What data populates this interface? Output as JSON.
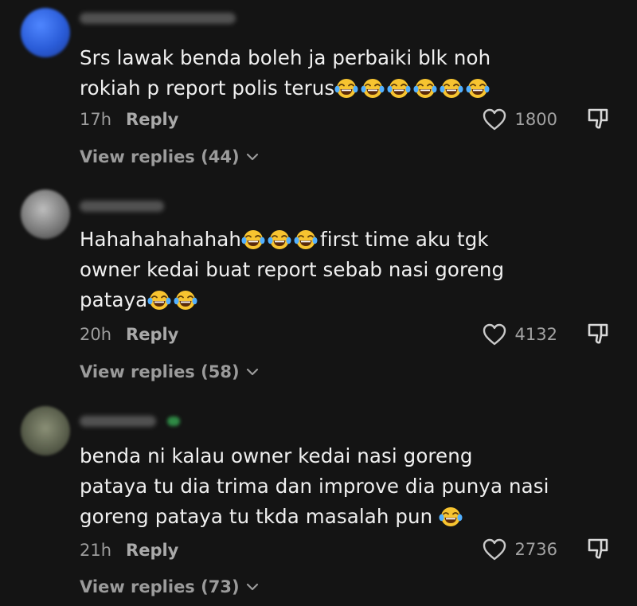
{
  "comments": [
    {
      "lines": [
        "Srs lawak benda boleh ja perbaiki blk noh",
        "rokiah p report polis terus"
      ],
      "trailing_emojis": [
        "tears-of-joy",
        "tears-of-joy",
        "tears-of-joy",
        "tears-of-joy",
        "tears-of-joy",
        "tears-of-joy"
      ],
      "time": "17h",
      "reply_label": "Reply",
      "likes": "1800",
      "view_replies": "View replies (44)"
    },
    {
      "lines": [
        "Hahahahahahah",
        "first time aku tgk",
        "owner kedai buat report sebab nasi goreng",
        "pataya"
      ],
      "time": "20h",
      "reply_label": "Reply",
      "likes": "4132",
      "view_replies": "View replies (58)"
    },
    {
      "lines": [
        "benda ni kalau owner kedai nasi goreng",
        "pataya tu dia trima dan improve dia punya nasi",
        "goreng pataya tu tkda masalah pun"
      ],
      "time": "21h",
      "reply_label": "Reply",
      "likes": "2736",
      "view_replies": "View replies (73)"
    }
  ],
  "colors": {
    "background": "#141414",
    "text": "#f0f0f0",
    "muted": "#9d9d9d",
    "emoji": "#f7c430"
  }
}
